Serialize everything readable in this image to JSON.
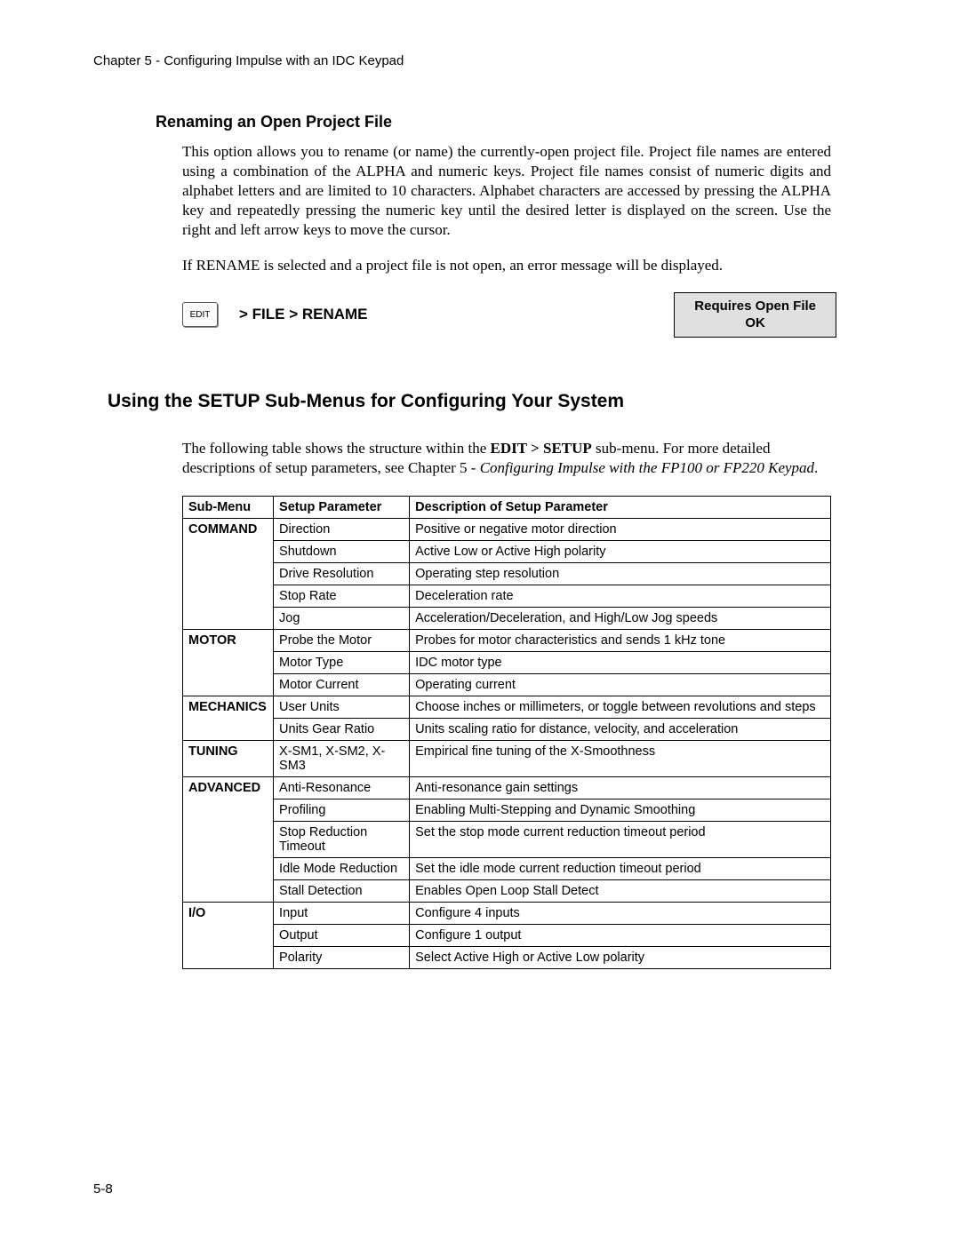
{
  "chapterHeader": "Chapter 5 - Configuring Impulse with an IDC Keypad",
  "sectionTitle": "Renaming an Open Project File",
  "para1": "This option allows you to rename (or name) the currently-open project file. Project file names are entered using a combination of the ALPHA and numeric keys. Project file names consist of numeric digits and alphabet letters and are limited to 10 characters. Alphabet characters are accessed by pressing the ALPHA key and repeatedly pressing the numeric key until the desired letter is displayed on the screen. Use the right and left arrow keys to move the cursor.",
  "para2": "If RENAME is selected and a project file is not open, an error message will be displayed.",
  "editBtn": "EDIT",
  "breadcrumb": "> FILE > RENAME",
  "msgBox": {
    "line1": "Requires Open File",
    "line2": "OK"
  },
  "mainTitle": "Using the SETUP Sub-Menus for Configuring Your System",
  "intro": {
    "pre": "The following table shows the structure within the ",
    "bold": "EDIT > SETUP",
    "mid": " sub-menu. For more detailed descriptions of setup parameters, see Chapter 5 - ",
    "ital": "Configuring Impulse with the FP100 or FP220 Keypad",
    "post": "."
  },
  "tableHeaders": [
    "Sub-Menu",
    "Setup Parameter",
    "Description of Setup Parameter"
  ],
  "rows": [
    {
      "sub": "COMMAND",
      "param": "Direction",
      "desc": "Positive or negative motor direction"
    },
    {
      "sub": "",
      "param": "Shutdown",
      "desc": "Active Low or Active High polarity"
    },
    {
      "sub": "",
      "param": "Drive Resolution",
      "desc": "Operating step resolution"
    },
    {
      "sub": "",
      "param": "Stop Rate",
      "desc": "Deceleration rate"
    },
    {
      "sub": "",
      "param": "Jog",
      "desc": "Acceleration/Deceleration, and High/Low Jog speeds"
    },
    {
      "sub": "MOTOR",
      "param": "Probe the Motor",
      "desc": "Probes for motor characteristics and sends 1 kHz tone"
    },
    {
      "sub": "",
      "param": "Motor Type",
      "desc": "IDC motor type"
    },
    {
      "sub": "",
      "param": "Motor Current",
      "desc": "Operating current"
    },
    {
      "sub": "MECHANICS",
      "param": "User Units",
      "desc": "Choose inches or millimeters, or toggle between revolutions and steps"
    },
    {
      "sub": "",
      "param": "Units Gear Ratio",
      "desc": "Units scaling ratio for distance, velocity, and acceleration"
    },
    {
      "sub": "TUNING",
      "param": "X-SM1, X-SM2, X-SM3",
      "desc": "Empirical fine tuning of the X-Smoothness"
    },
    {
      "sub": "ADVANCED",
      "param": "Anti-Resonance",
      "desc": "Anti-resonance gain settings"
    },
    {
      "sub": "",
      "param": "Profiling",
      "desc": "Enabling Multi-Stepping and Dynamic Smoothing"
    },
    {
      "sub": "",
      "param": "Stop Reduction Timeout",
      "desc": "Set the stop mode current reduction timeout period"
    },
    {
      "sub": "",
      "param": "Idle Mode Reduction",
      "desc": "Set the idle mode current reduction timeout period"
    },
    {
      "sub": "",
      "param": "Stall Detection",
      "desc": "Enables Open Loop Stall Detect"
    },
    {
      "sub": "I/O",
      "param": "Input",
      "desc": "Configure 4 inputs"
    },
    {
      "sub": "",
      "param": "Output",
      "desc": "Configure 1 output"
    },
    {
      "sub": "",
      "param": "Polarity",
      "desc": "Select Active High or Active Low polarity"
    }
  ],
  "pageNumber": "5-8"
}
